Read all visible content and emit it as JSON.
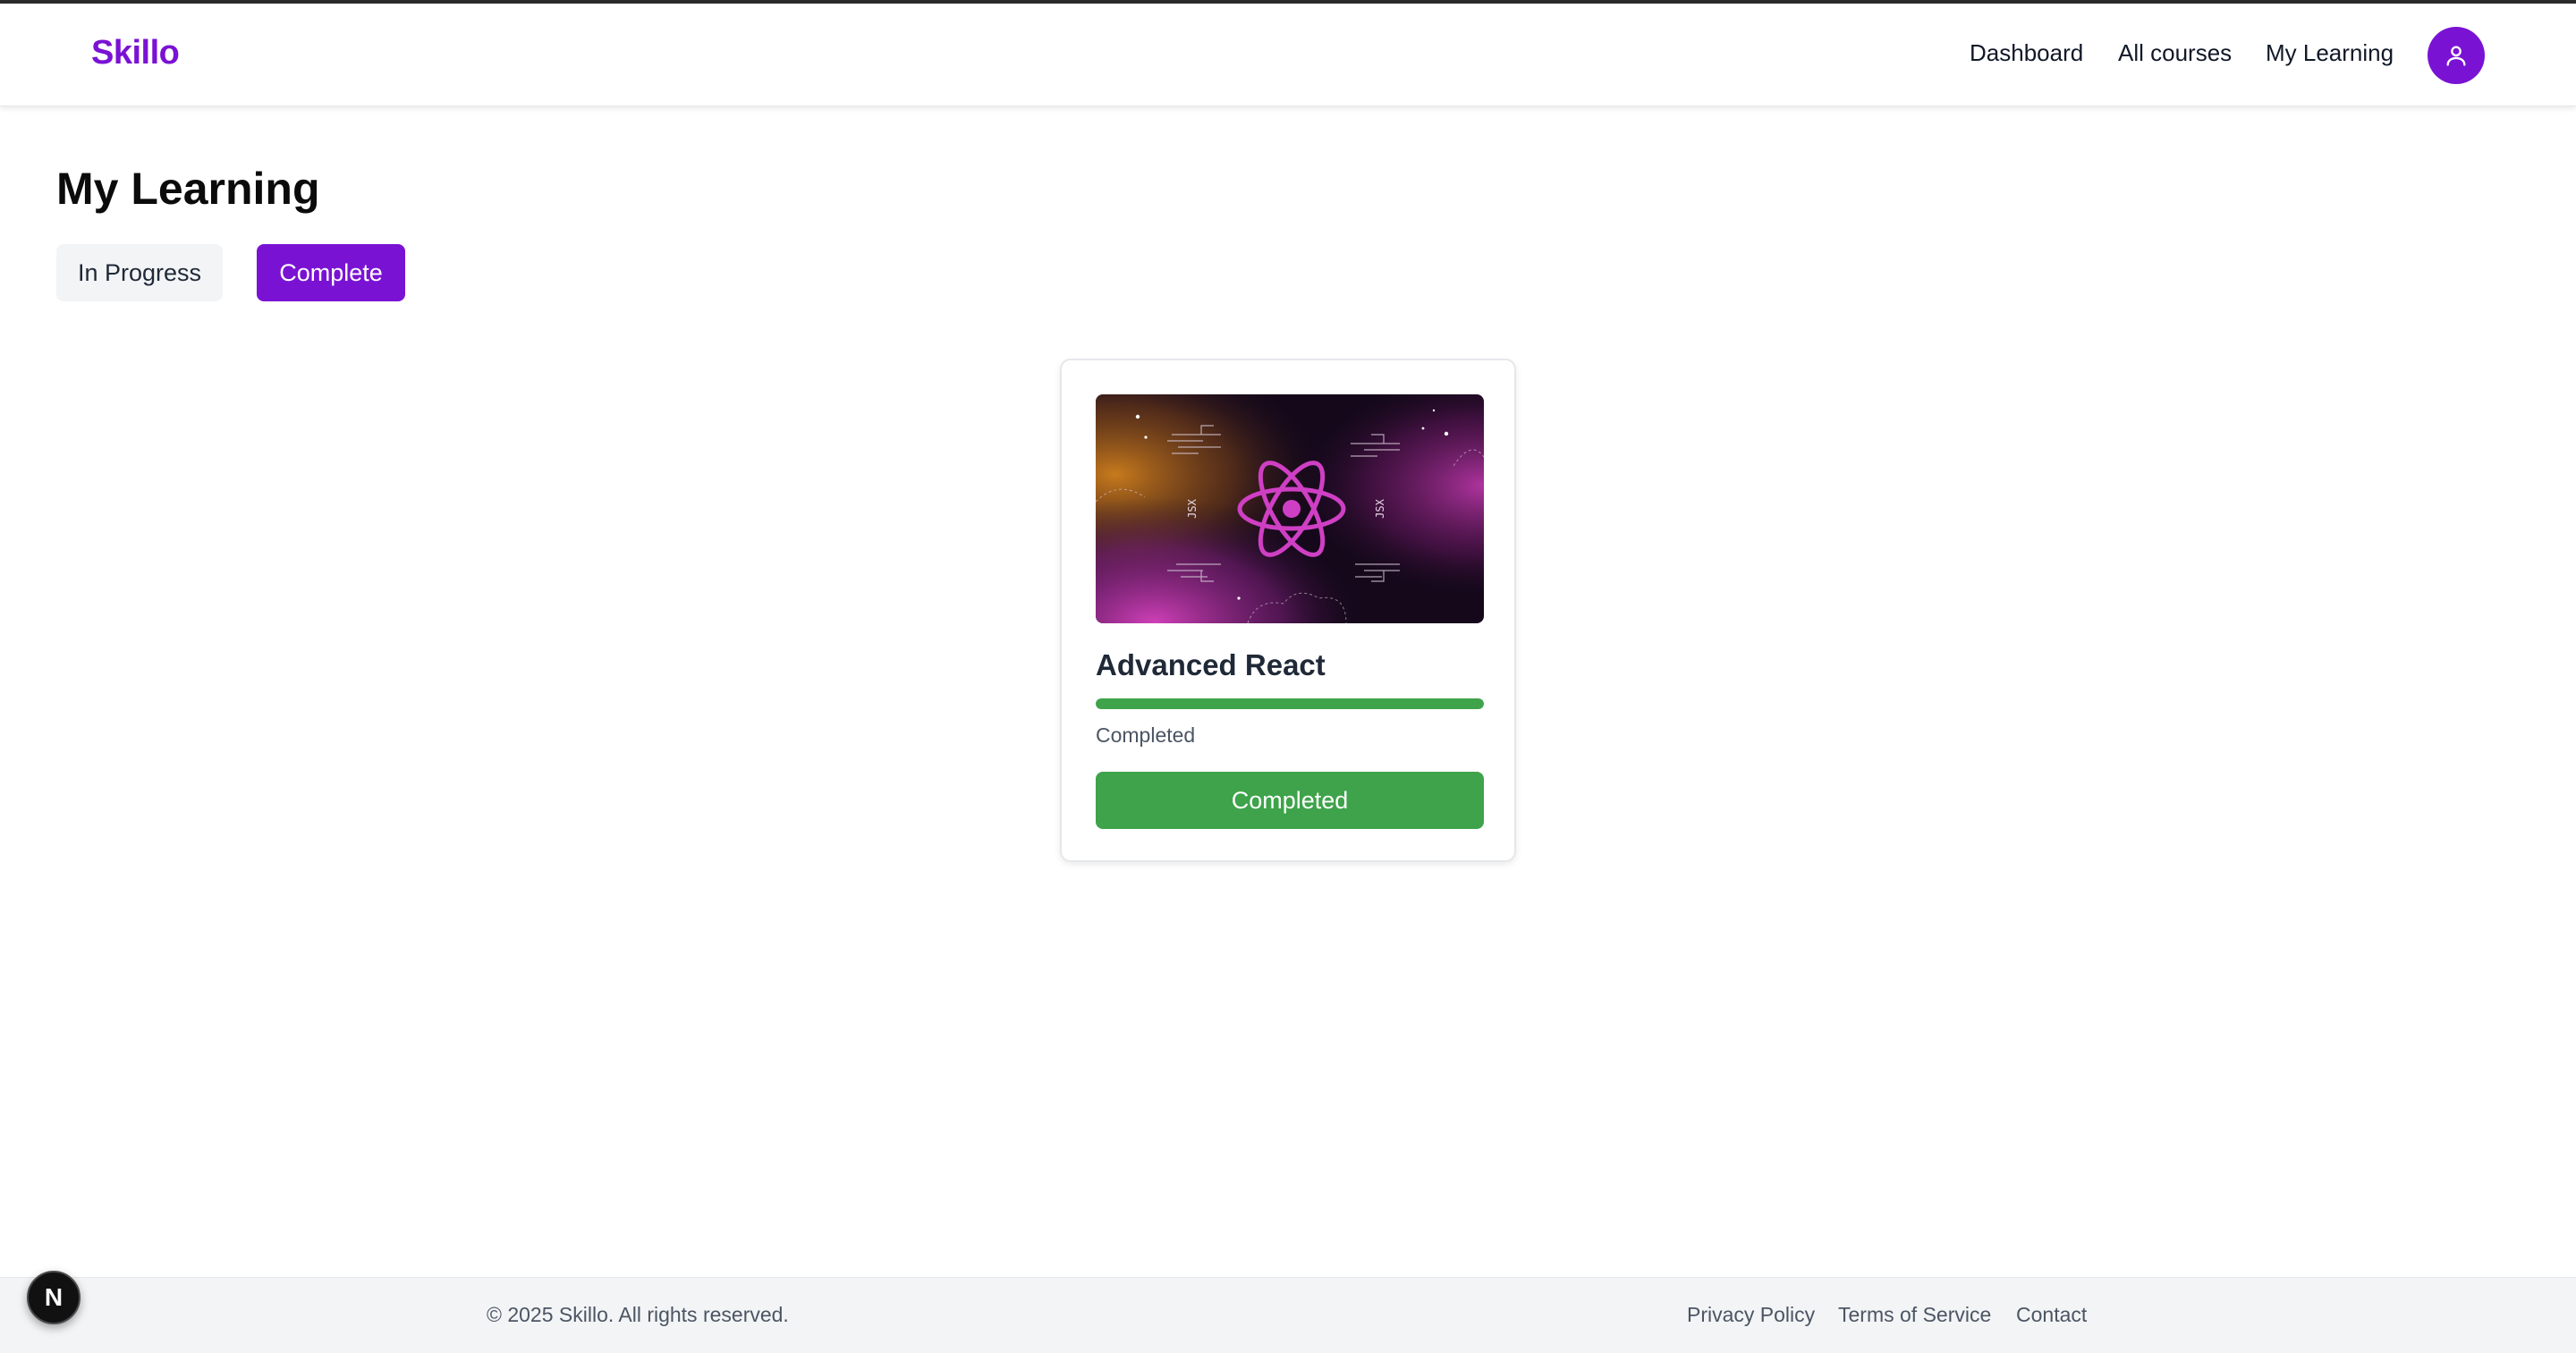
{
  "brand": {
    "name": "Skillo",
    "color": "#7a12d4"
  },
  "nav": {
    "links": [
      "Dashboard",
      "All courses",
      "My Learning"
    ],
    "avatar_icon": "user-icon"
  },
  "page": {
    "title": "My Learning",
    "tabs": [
      {
        "label": "In Progress",
        "active": false
      },
      {
        "label": "Complete",
        "active": true
      }
    ]
  },
  "courses": [
    {
      "title": "Advanced React",
      "thumbnail_labels": [
        "JSX",
        "JSX"
      ],
      "progress": 1.0,
      "status": "Completed",
      "button_label": "Completed",
      "status_color": "#3ea34a"
    }
  ],
  "footer": {
    "copyright": "© 2025 Skillo. All rights reserved.",
    "links": [
      "Privacy Policy",
      "Terms of Service",
      "Contact"
    ]
  },
  "dev_badge": {
    "label": "N",
    "icon": "nextjs-icon"
  }
}
